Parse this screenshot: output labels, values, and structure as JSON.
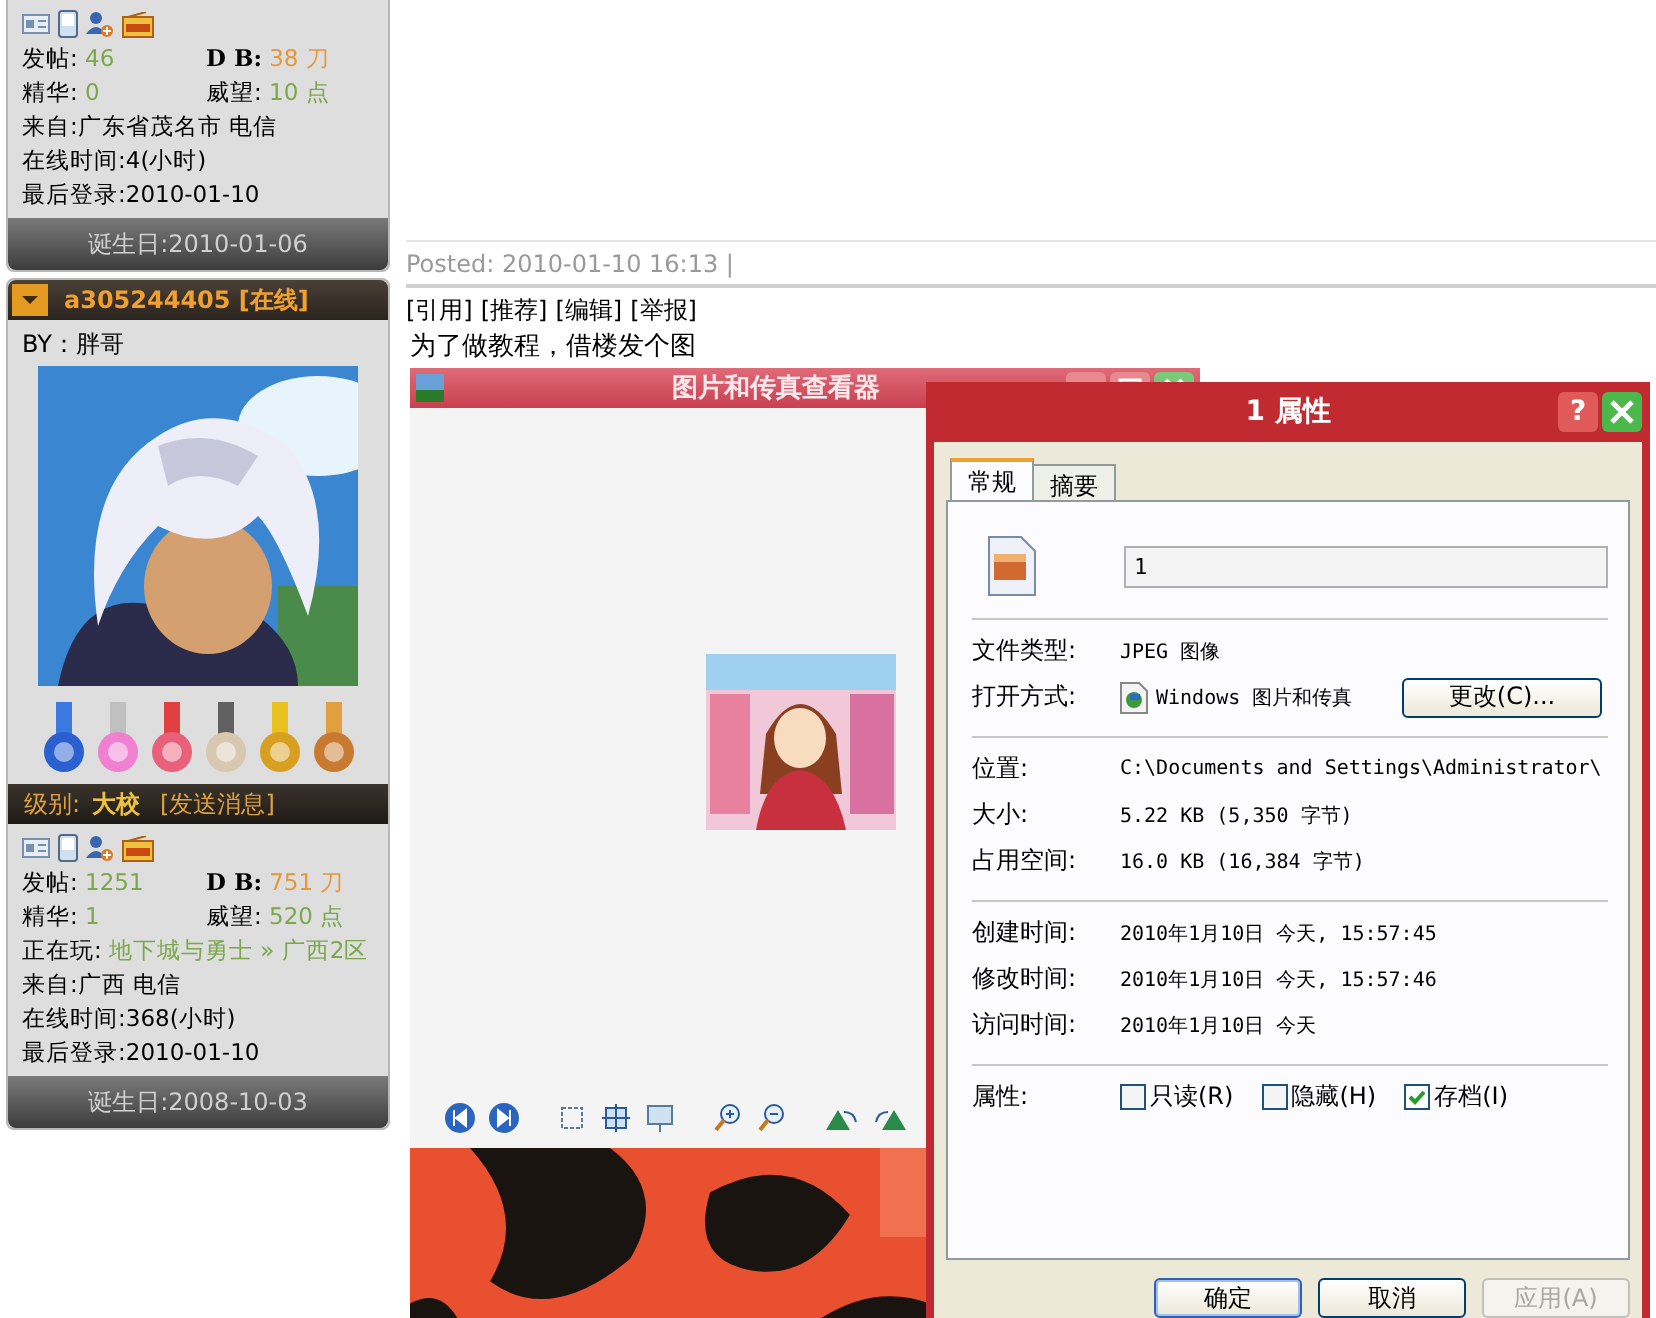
{
  "profiles": [
    {
      "stats": [
        {
          "label": "发帖:",
          "value": "46",
          "color": "#7aa84a",
          "bold": false
        },
        {
          "label": "D B:",
          "value": "38 刀",
          "color": "#e8963a",
          "bold": true
        },
        {
          "label": "精华:",
          "value": "0",
          "color": "#7aa84a",
          "bold": false
        },
        {
          "label": "威望:",
          "value": "10 点",
          "color": "#7aa84a",
          "bold": false
        }
      ],
      "lines": [
        "来自:广东省茂名市 电信",
        "在线时间:4(小时)",
        "最后登录:2010-01-10"
      ],
      "birthday": "诞生日:2010-01-06"
    },
    {
      "username": "a305244405 [在线]",
      "by": "BY：胖哥",
      "level_label": "级别:",
      "level_value": "大校",
      "message_link": "[发送消息]",
      "stats": [
        {
          "label": "发帖:",
          "value": "1251",
          "color": "#7aa84a",
          "bold": false
        },
        {
          "label": "D B:",
          "value": "751 刀",
          "color": "#e8963a",
          "bold": true
        },
        {
          "label": "精华:",
          "value": "1",
          "color": "#7aa84a",
          "bold": false
        },
        {
          "label": "威望:",
          "value": "520 点",
          "color": "#7aa84a",
          "bold": false
        }
      ],
      "playing": {
        "label": "正在玩:",
        "value": "地下城与勇士 » 广西2区"
      },
      "lines": [
        "来自:广西 电信",
        "在线时间:368(小时)",
        "最后登录:2010-01-10"
      ],
      "birthday": "诞生日:2008-10-03"
    }
  ],
  "post": {
    "posted": "Posted: 2010-01-10 16:13 |",
    "actions": [
      "[引用]",
      "[推荐]",
      "[编辑]",
      "[举报]"
    ],
    "text": "为了做教程，借楼发个图"
  },
  "viewer": {
    "title": "图片和传真查看器"
  },
  "dialog": {
    "title": "1 属性",
    "help": "?",
    "tabs": [
      {
        "label": "常规",
        "selected": true
      },
      {
        "label": "摘要",
        "selected": false
      }
    ],
    "filename": "1",
    "groups": [
      [
        {
          "label": "文件类型:",
          "value": "JPEG 图像",
          "kind": "text"
        },
        {
          "label": "打开方式:",
          "value": "Windows 图片和传真",
          "kind": "app",
          "button": "更改(C)..."
        }
      ],
      [
        {
          "label": "位置:",
          "value": "C:\\Documents and Settings\\Administrator\\",
          "kind": "text"
        },
        {
          "label": "大小:",
          "value": "5.22 KB (5,350 字节)",
          "kind": "text"
        },
        {
          "label": "占用空间:",
          "value": "16.0 KB (16,384 字节)",
          "kind": "text"
        }
      ],
      [
        {
          "label": "创建时间:",
          "value": "2010年1月10日 今天, 15:57:45",
          "kind": "text"
        },
        {
          "label": "修改时间:",
          "value": "2010年1月10日 今天, 15:57:46",
          "kind": "text"
        },
        {
          "label": "访问时间:",
          "value": "2010年1月10日 今天",
          "kind": "text"
        }
      ]
    ],
    "attributes_label": "属性:",
    "attributes": [
      {
        "label": "只读(R)",
        "checked": false
      },
      {
        "label": "隐藏(H)",
        "checked": false
      },
      {
        "label": "存档(I)",
        "checked": true
      }
    ],
    "buttons": [
      {
        "label": "确定",
        "disabled": false,
        "default": true
      },
      {
        "label": "取消",
        "disabled": false,
        "default": false
      },
      {
        "label": "应用(A)",
        "disabled": true,
        "default": false
      }
    ]
  }
}
